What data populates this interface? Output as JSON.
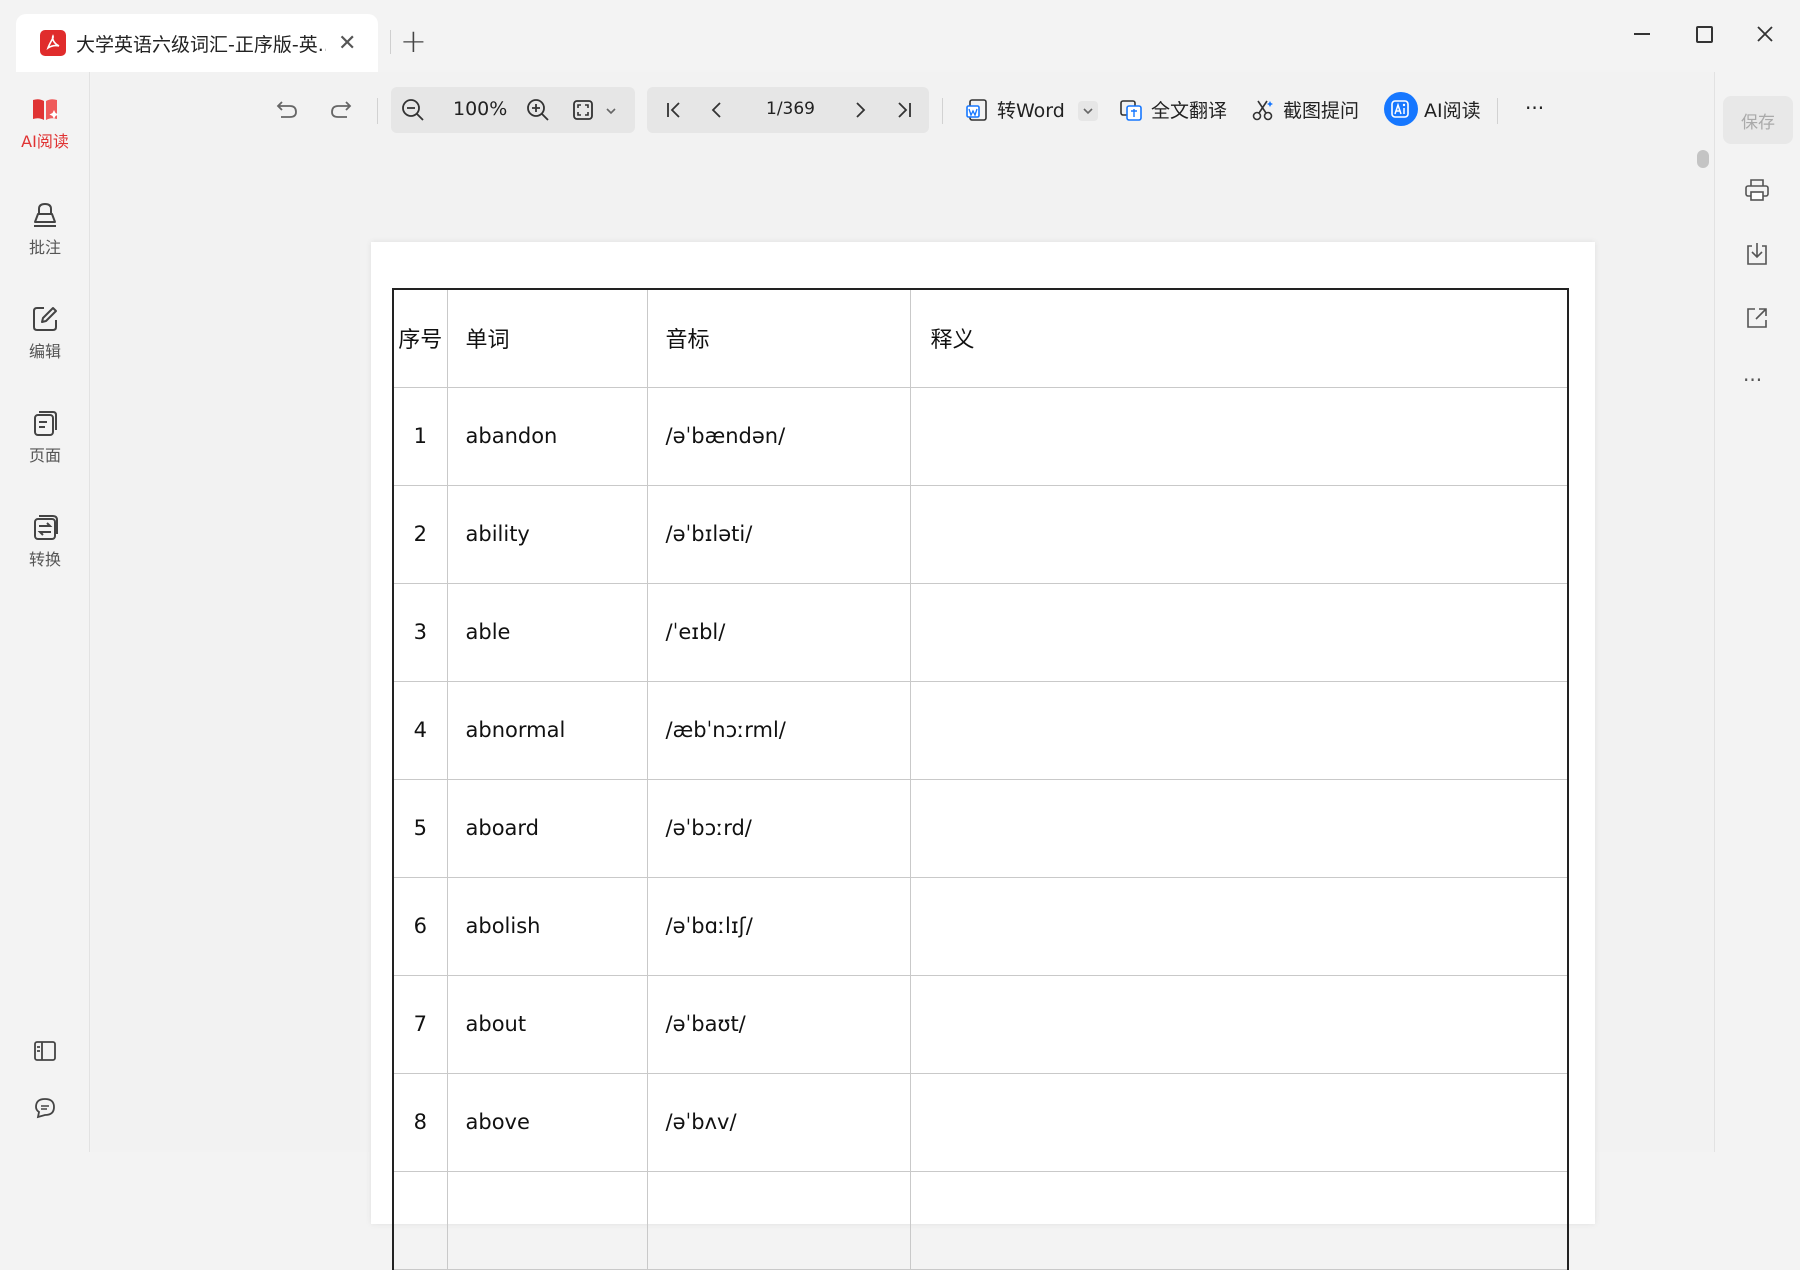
{
  "tab": {
    "title": "大学英语六级词汇-正序版-英...",
    "close": "✕",
    "new_tab": "+"
  },
  "left_sidebar": {
    "items": [
      {
        "label": "AI阅读",
        "icon": "ai-read-icon"
      },
      {
        "label": "批注",
        "icon": "annotate-icon"
      },
      {
        "label": "编辑",
        "icon": "edit-icon"
      },
      {
        "label": "页面",
        "icon": "pages-icon"
      },
      {
        "label": "转换",
        "icon": "convert-icon"
      }
    ],
    "bottom_icons": [
      "panel-toggle-icon",
      "comment-icon"
    ]
  },
  "toolbar": {
    "zoom": "100%",
    "page_indicator": "1/369",
    "to_word": "转Word",
    "translate": "全文翻译",
    "screenshot_ask": "截图提问",
    "ai_read": "AI阅读",
    "more": "···"
  },
  "right_panel": {
    "save": "保存",
    "more": "···"
  },
  "table": {
    "headers": [
      "序号",
      "单词",
      "音标",
      "释义"
    ],
    "rows": [
      [
        "1",
        "abandon",
        "/əˈbændən/",
        ""
      ],
      [
        "2",
        "ability",
        "/əˈbɪləti/",
        ""
      ],
      [
        "3",
        "able",
        "/ˈeɪbl/",
        ""
      ],
      [
        "4",
        "abnormal",
        "/æbˈnɔːrml/",
        ""
      ],
      [
        "5",
        "aboard",
        "/əˈbɔːrd/",
        ""
      ],
      [
        "6",
        "abolish",
        "/əˈbɑːlɪʃ/",
        ""
      ],
      [
        "7",
        "about",
        "/əˈbaʊt/",
        ""
      ],
      [
        "8",
        "above",
        "/əˈbʌv/",
        ""
      ],
      [
        "",
        "",
        "",
        ""
      ]
    ]
  },
  "colors": {
    "accent": "#e03333",
    "ai_blue": "#1677ff",
    "pdf_red": "#e02c2c"
  }
}
